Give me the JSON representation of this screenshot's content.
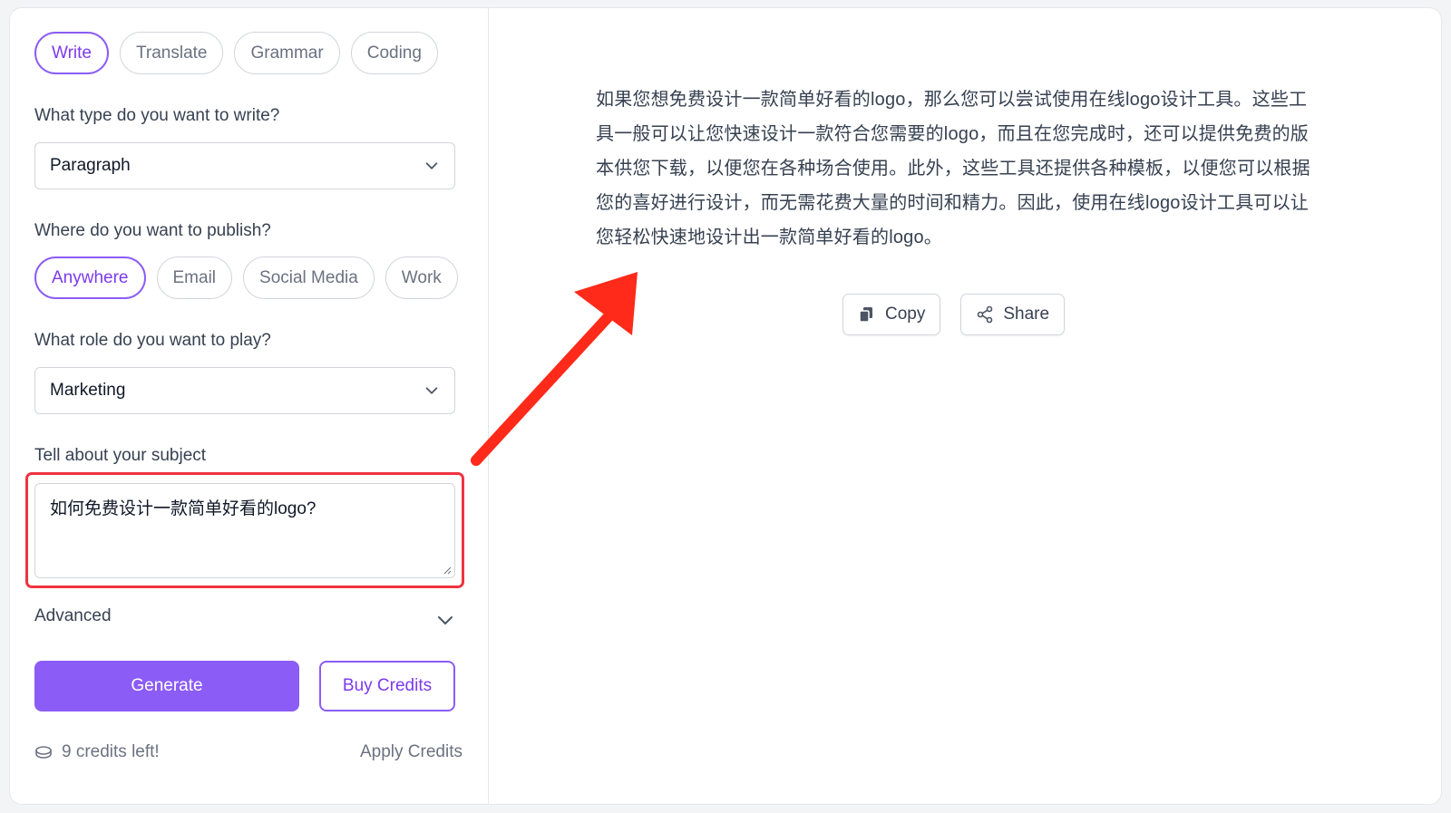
{
  "tabs": [
    {
      "label": "Write",
      "active": true
    },
    {
      "label": "Translate",
      "active": false
    },
    {
      "label": "Grammar",
      "active": false
    },
    {
      "label": "Coding",
      "active": false
    }
  ],
  "type_section": {
    "label": "What type do you want to write?",
    "selected": "Paragraph"
  },
  "publish_section": {
    "label": "Where do you want to publish?",
    "options": [
      {
        "label": "Anywhere",
        "active": true
      },
      {
        "label": "Email",
        "active": false
      },
      {
        "label": "Social Media",
        "active": false
      },
      {
        "label": "Work",
        "active": false
      }
    ]
  },
  "role_section": {
    "label": "What role do you want to play?",
    "selected": "Marketing"
  },
  "subject_section": {
    "label": "Tell about your subject",
    "value": "如何免费设计一款简单好看的logo?"
  },
  "advanced": {
    "label": "Advanced"
  },
  "buttons": {
    "generate": "Generate",
    "buy_credits": "Buy Credits"
  },
  "credits": {
    "text": "9 credits left!",
    "apply": "Apply Credits"
  },
  "result": {
    "text": "如果您想免费设计一款简单好看的logo，那么您可以尝试使用在线logo设计工具。这些工具一般可以让您快速设计一款符合您需要的logo，而且在您完成时，还可以提供免费的版本供您下载，以便您在各种场合使用。此外，这些工具还提供各种模板，以便您可以根据您的喜好进行设计，而无需花费大量的时间和精力。因此，使用在线logo设计工具可以让您轻松快速地设计出一款简单好看的logo。",
    "copy_label": "Copy",
    "share_label": "Share"
  },
  "colors": {
    "accent": "#8b5cf6",
    "highlight": "#ef3340",
    "annotation_arrow": "#ff2a1a"
  }
}
